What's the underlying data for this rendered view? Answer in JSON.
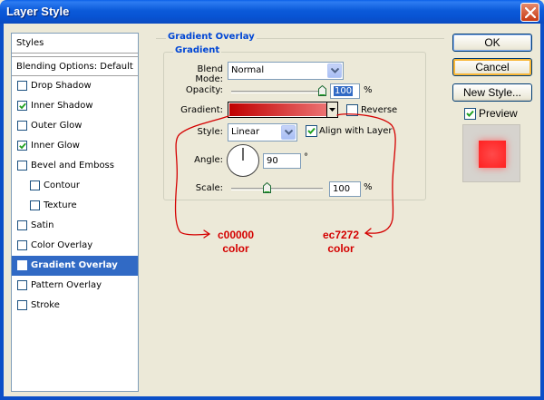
{
  "window": {
    "title": "Layer Style"
  },
  "styles_panel": {
    "header": "Styles",
    "blending_options": "Blending Options: Default",
    "items": [
      {
        "label": "Drop Shadow",
        "checked": false,
        "level": 0,
        "selected": false
      },
      {
        "label": "Inner Shadow",
        "checked": true,
        "level": 0,
        "selected": false
      },
      {
        "label": "Outer Glow",
        "checked": false,
        "level": 0,
        "selected": false
      },
      {
        "label": "Inner Glow",
        "checked": true,
        "level": 0,
        "selected": false
      },
      {
        "label": "Bevel and Emboss",
        "checked": false,
        "level": 0,
        "selected": false
      },
      {
        "label": "Contour",
        "checked": false,
        "level": 1,
        "selected": false
      },
      {
        "label": "Texture",
        "checked": false,
        "level": 1,
        "selected": false
      },
      {
        "label": "Satin",
        "checked": false,
        "level": 0,
        "selected": false
      },
      {
        "label": "Color Overlay",
        "checked": false,
        "level": 0,
        "selected": false
      },
      {
        "label": "Gradient Overlay",
        "checked": true,
        "level": 0,
        "selected": true
      },
      {
        "label": "Pattern Overlay",
        "checked": false,
        "level": 0,
        "selected": false
      },
      {
        "label": "Stroke",
        "checked": false,
        "level": 0,
        "selected": false
      }
    ]
  },
  "gradient_overlay": {
    "section_title": "Gradient Overlay",
    "group_title": "Gradient",
    "blend_mode_label": "Blend Mode:",
    "blend_mode_value": "Normal",
    "opacity_label": "Opacity:",
    "opacity_value": "100",
    "opacity_unit": "%",
    "opacity_level": 1.0,
    "gradient_label": "Gradient:",
    "gradient_colors": [
      "#c00000",
      "#ec7272"
    ],
    "reverse_label": "Reverse",
    "reverse_checked": false,
    "style_label": "Style:",
    "style_value": "Linear",
    "align_label": "Align with Layer",
    "align_checked": true,
    "angle_label": "Angle:",
    "angle_value": "90",
    "angle_unit": "°",
    "scale_label": "Scale:",
    "scale_value": "100",
    "scale_unit": "%",
    "scale_level": 0.4
  },
  "buttons": {
    "ok": "OK",
    "cancel": "Cancel",
    "new_style": "New Style...",
    "preview_label": "Preview",
    "preview_checked": true
  },
  "annotations": {
    "left_code": "c00000",
    "left_word": "color",
    "right_code": "ec7272",
    "right_word": "color",
    "color": "#d40000"
  }
}
